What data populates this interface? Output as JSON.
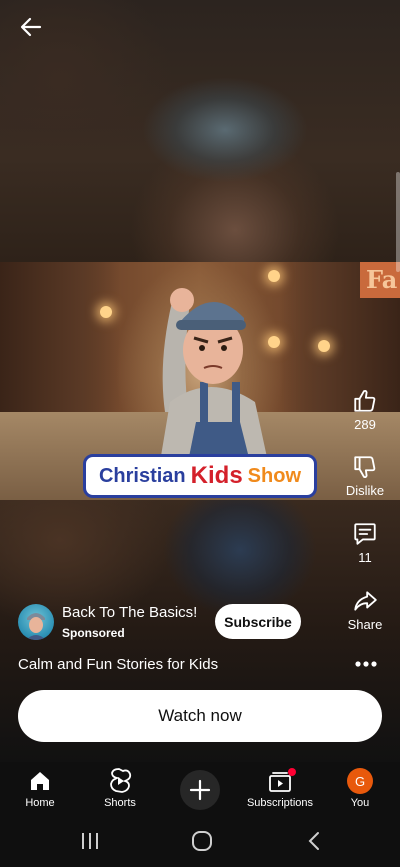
{
  "video": {
    "logo_word1": "Christian",
    "logo_word2": "Kids",
    "logo_word3": "Show",
    "sign_letter": "Fa"
  },
  "actions": {
    "like_count": "289",
    "dislike_label": "Dislike",
    "comment_count": "11",
    "share_label": "Share"
  },
  "channel": {
    "name": "Back To The Basics!",
    "sponsored_label": "Sponsored",
    "subscribe_label": "Subscribe"
  },
  "ad": {
    "description": "Calm and Fun Stories for Kids",
    "cta_label": "Watch now"
  },
  "bottom_nav": {
    "items": [
      {
        "label": "Home",
        "icon": "home-icon"
      },
      {
        "label": "Shorts",
        "icon": "shorts-icon"
      },
      {
        "label": "",
        "icon": "plus-icon"
      },
      {
        "label": "Subscriptions",
        "icon": "subscriptions-icon"
      },
      {
        "label": "You",
        "icon": "avatar"
      }
    ],
    "avatar_letter": "G"
  },
  "colors": {
    "logo_blue": "#2a3f9e",
    "logo_red": "#d4202a",
    "logo_orange": "#f08a1c",
    "avatar_orange": "#e8590c",
    "notification_red": "#ff0033"
  }
}
